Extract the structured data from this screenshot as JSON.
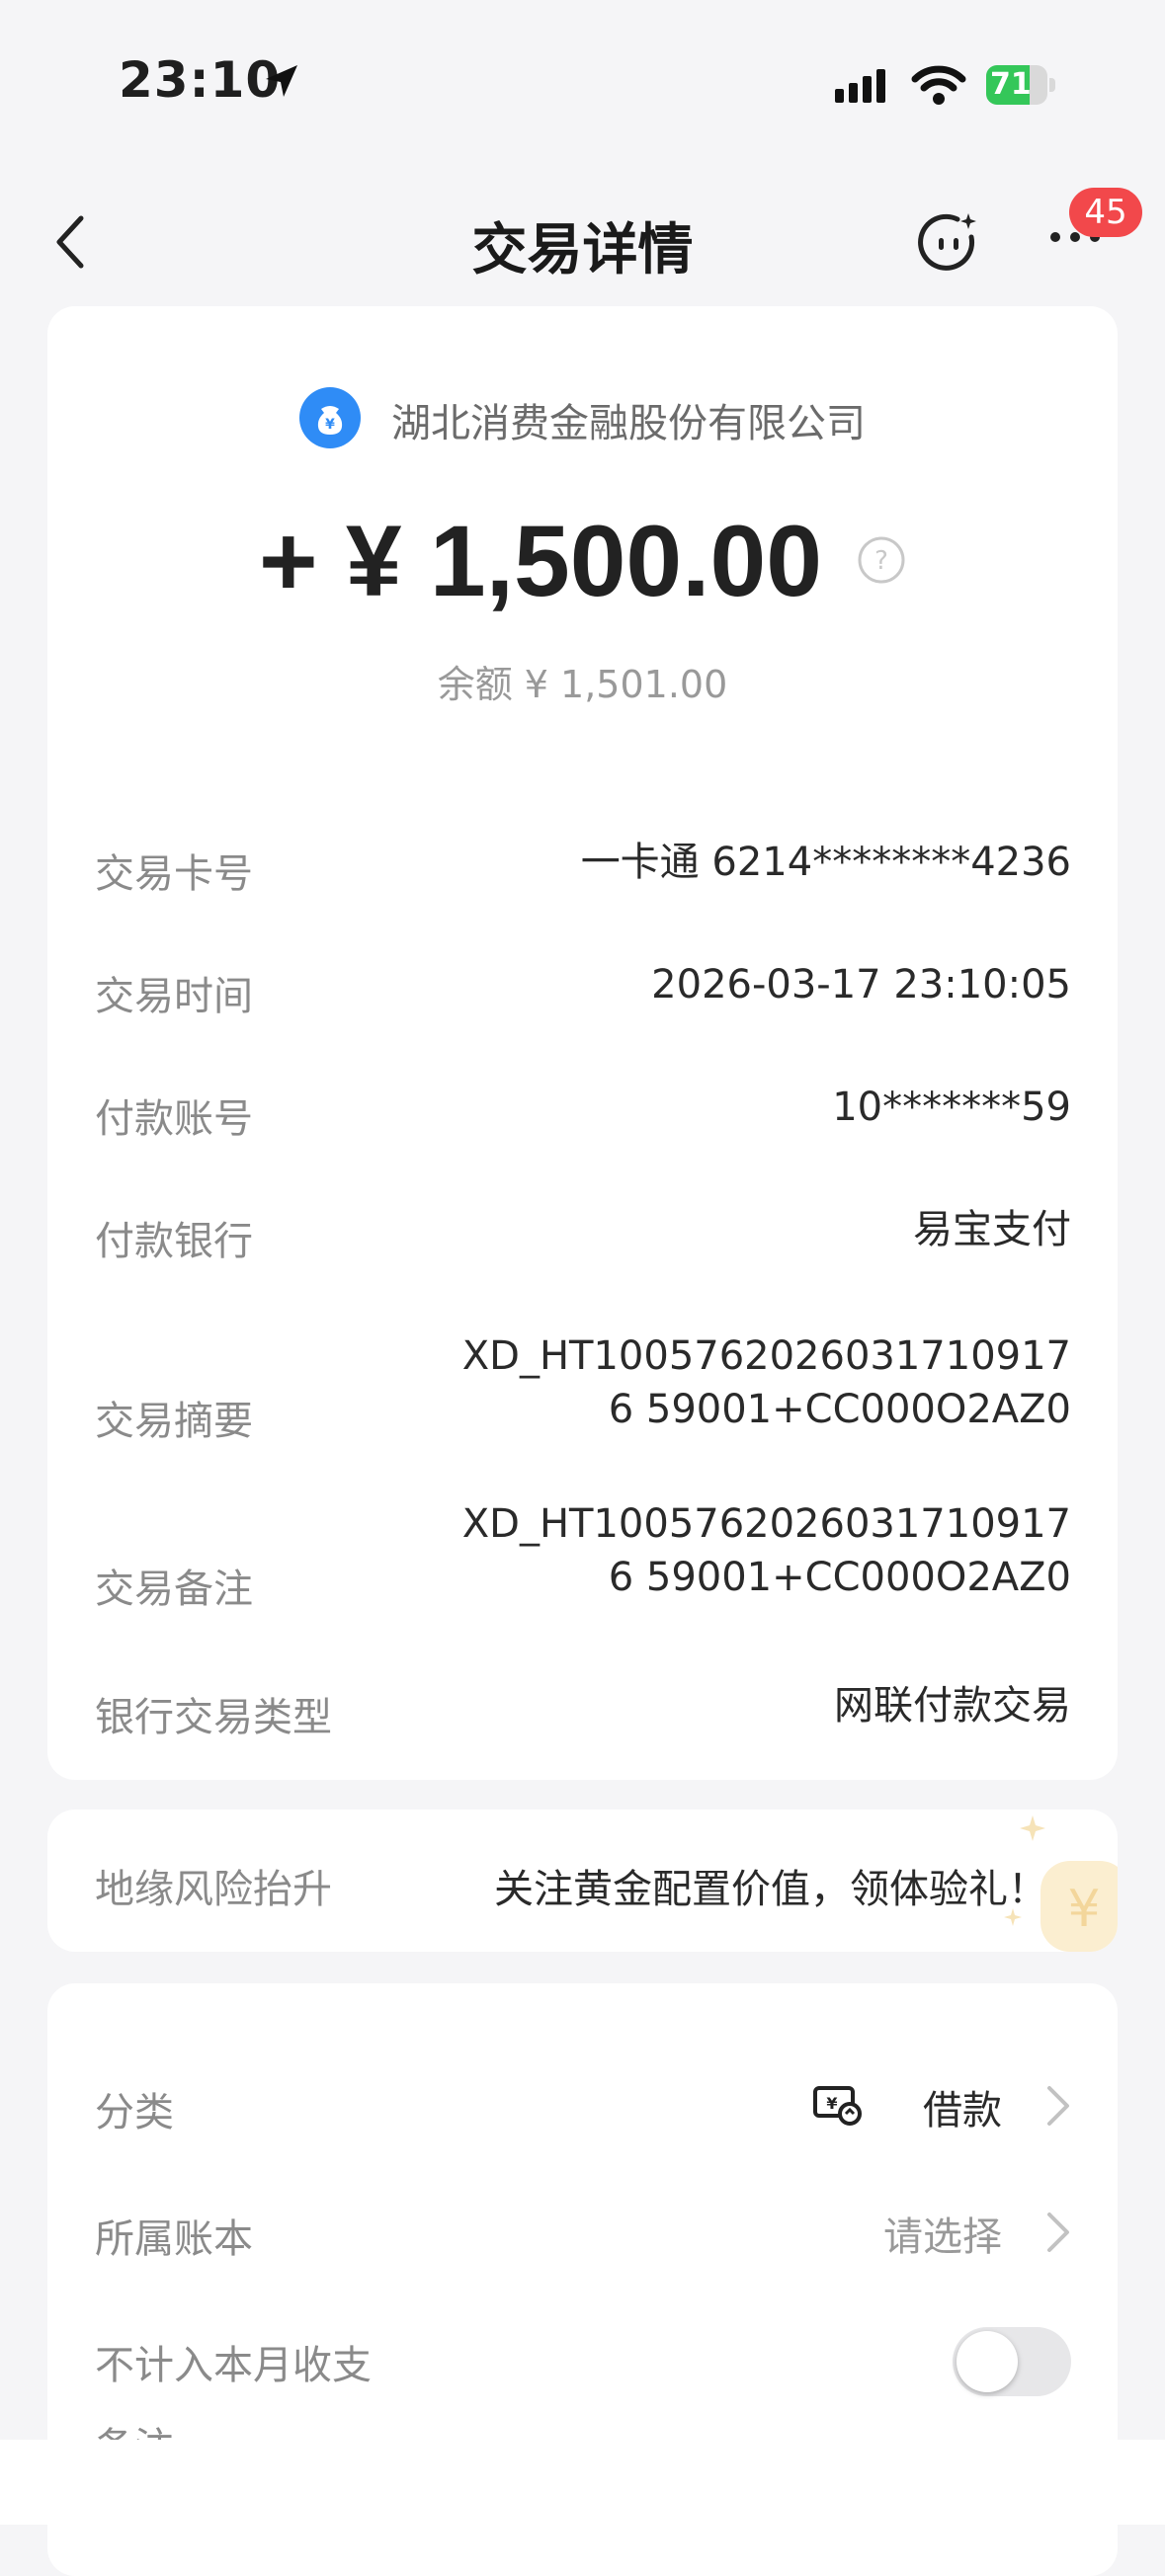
{
  "status_bar": {
    "time": "23:10",
    "battery": "71",
    "battery_level_percent": 71,
    "icons": [
      "location-arrow-icon",
      "signal-icon",
      "wifi-icon",
      "battery-icon"
    ]
  },
  "nav": {
    "title": "交易详情",
    "badge_count": "45",
    "icons": [
      "back-icon",
      "assistant-icon",
      "more-icon"
    ]
  },
  "transaction": {
    "merchant": "湖北消费金融股份有限公司",
    "amount": "+ ¥ 1,500.00",
    "balance": "余额 ¥ 1,501.00",
    "details": [
      {
        "label": "交易卡号",
        "value": "一卡通 6214********4236"
      },
      {
        "label": "交易时间",
        "value": "2026-03-17 23:10:05"
      },
      {
        "label": "付款账号",
        "value": "10*******59"
      },
      {
        "label": "付款银行",
        "value": "易宝支付"
      },
      {
        "label": "交易摘要",
        "value": "XD_HT10057620260317109176 59001+CC000O2AZ0"
      },
      {
        "label": "交易备注",
        "value": "XD_HT10057620260317109176 59001+CC000O2AZ0"
      },
      {
        "label": "银行交易类型",
        "value": "网联付款交易"
      }
    ]
  },
  "promo": {
    "label": "地缘风险抬升",
    "text": "关注黄金配置价值，领体验礼！"
  },
  "settings": {
    "category_label": "分类",
    "category_value": "借款",
    "ledger_label": "所属账本",
    "ledger_value": "请选择",
    "exclude_label": "不计入本月收支",
    "exclude_enabled": false,
    "note_label": "备注"
  },
  "colors": {
    "accent_blue": "#2f8cf6",
    "badge_red": "#f2484b",
    "battery_green": "#34c759"
  }
}
